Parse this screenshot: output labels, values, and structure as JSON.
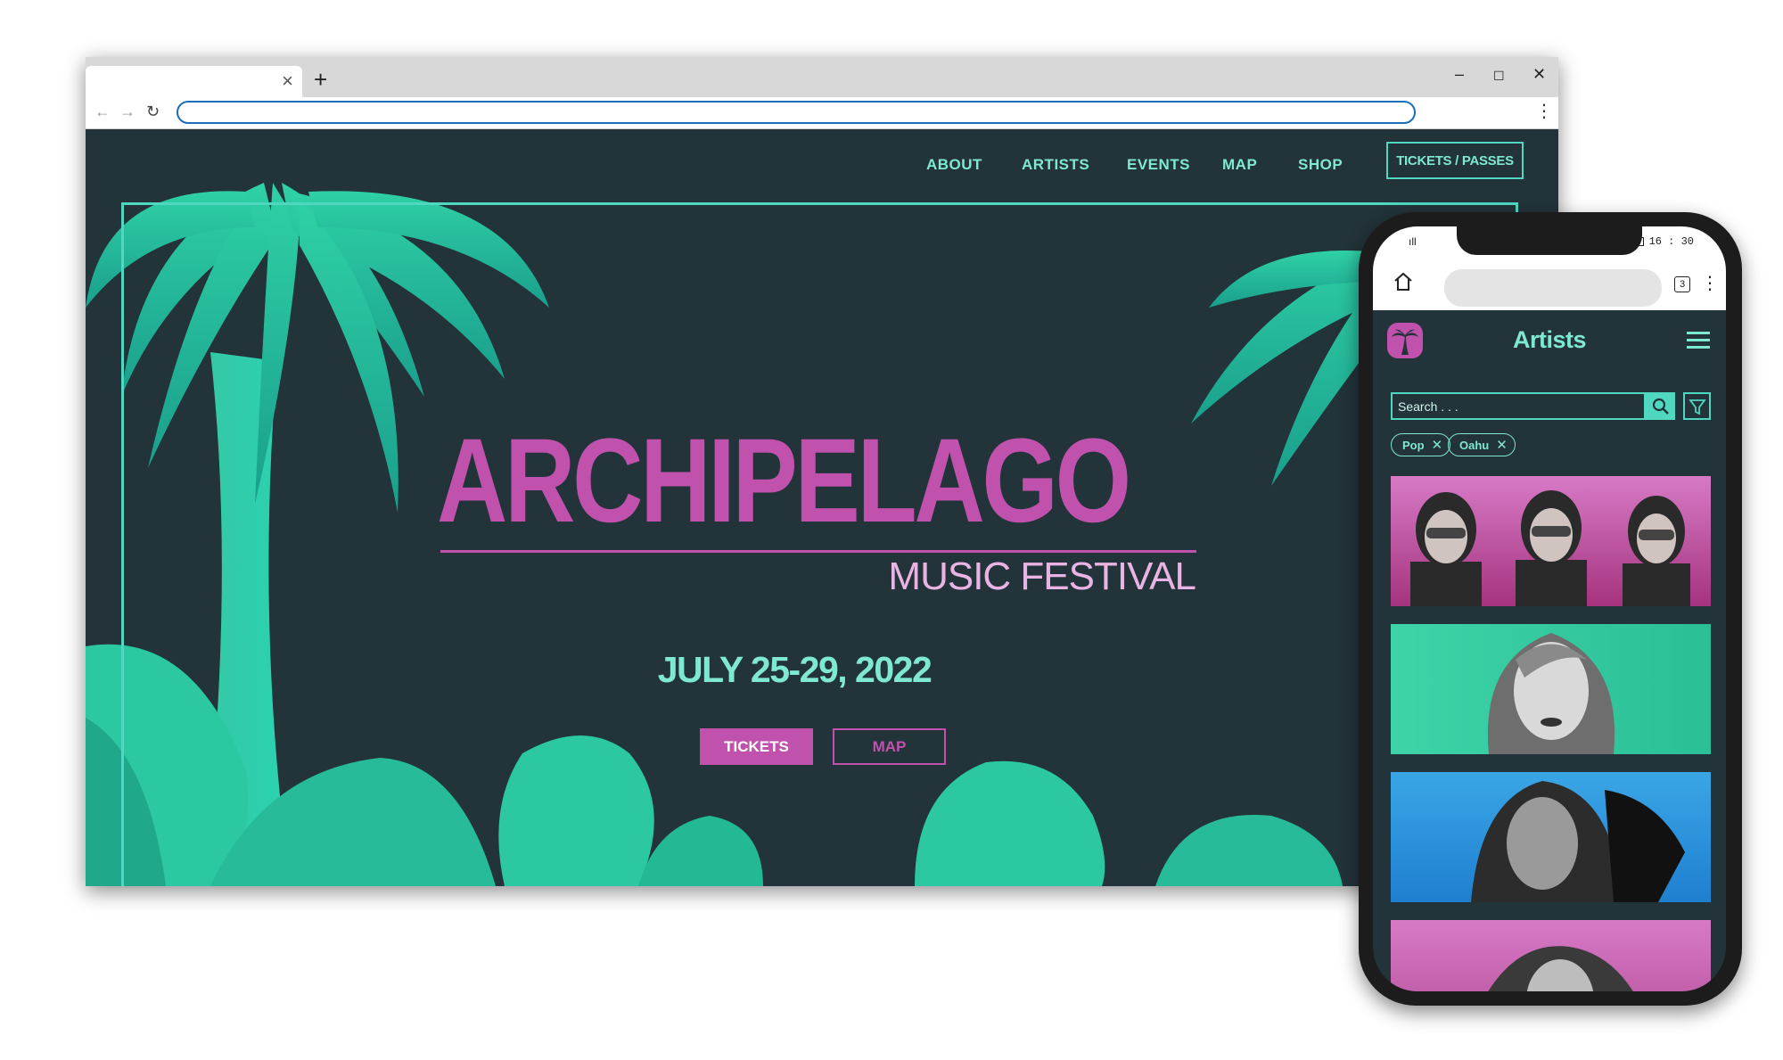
{
  "browser": {
    "tab_close_glyph": "×",
    "new_tab_glyph": "+",
    "window_controls": {
      "minimize": "–",
      "maximize": "☐",
      "close": "✕"
    },
    "nav": {
      "back": "←",
      "forward": "→",
      "reload": "↻"
    },
    "address_value": "",
    "menu_glyph": "⋮"
  },
  "site": {
    "nav_items": [
      "ABOUT",
      "ARTISTS",
      "EVENTS",
      "MAP",
      "SHOP"
    ],
    "cta_label": "TICKETS / PASSES",
    "hero": {
      "title": "ARCHIPELAGO",
      "subtitle": "MUSIC FESTIVAL",
      "date": "JULY 25-29, 2022",
      "tickets_label": "TICKETS",
      "map_label": "MAP"
    },
    "colors": {
      "background": "#223339",
      "accent": "#4fd8bf",
      "magenta": "#c052ad",
      "text": "#7fe8d2"
    }
  },
  "phone": {
    "status": {
      "time": "16 : 30",
      "signal": "ıll"
    },
    "toolbar": {
      "url_value": "",
      "tab_count": "3",
      "menu_glyph": "⋮"
    },
    "app": {
      "title": "Artists",
      "search_placeholder": "Search . . .",
      "filters": [
        {
          "label": "Pop",
          "remove_glyph": "✕"
        },
        {
          "label": "Oahu",
          "remove_glyph": "✕"
        }
      ],
      "artist_cards": [
        {
          "name": "artist-group-card",
          "background": "magenta"
        },
        {
          "name": "artist-solo-card-1",
          "background": "teal"
        },
        {
          "name": "artist-solo-card-2",
          "background": "blue"
        },
        {
          "name": "artist-solo-card-3",
          "background": "magenta"
        }
      ]
    }
  }
}
